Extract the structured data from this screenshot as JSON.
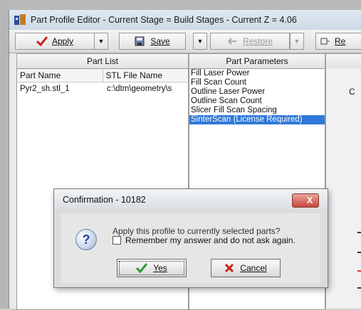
{
  "window": {
    "title": "Part Profile Editor - Current Stage = Build Stages - Current Z = 4.06"
  },
  "toolbar": {
    "apply_label": "Apply",
    "save_label": "Save",
    "restore_label": "Restore",
    "ref_label": "Re"
  },
  "part_list": {
    "header": "Part List",
    "columns": [
      "Part Name",
      "STL File Name"
    ],
    "rows": [
      {
        "name": "Pyr2_sh.stl_1",
        "file": "c:\\dtm\\geometry\\s"
      }
    ]
  },
  "part_parameters": {
    "header": "Part Parameters",
    "items": [
      "Fill Laser Power",
      "Fill Scan Count",
      "Outline Laser Power",
      "Outline Scan Count",
      "Slicer Fill Scan Spacing",
      "SinterScan (License Required)"
    ],
    "selected_index": 5
  },
  "right_pane": {
    "letter_c": "C"
  },
  "dialog": {
    "title": "Confirmation - 10182",
    "close_label": "X",
    "message": "Apply this profile to currently selected parts?",
    "checkbox_label": "Remember my answer and do not ask again.",
    "checkbox_checked": false,
    "yes_label": "Yes",
    "cancel_label": "Cancel"
  },
  "icon_names": [
    "app-icon",
    "checkmark-icon",
    "save-icon",
    "restore-icon",
    "question-icon",
    "cross-icon"
  ]
}
